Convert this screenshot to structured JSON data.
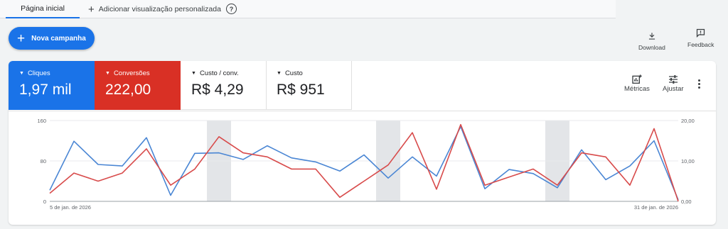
{
  "tabs": {
    "home": "Página inicial",
    "add_view": "Adicionar visualização personalizada"
  },
  "new_campaign": "Nova campanha",
  "tools": {
    "download": "Download",
    "feedback": "Feedback"
  },
  "metrics": [
    {
      "label": "Cliques",
      "value": "1,97 mil",
      "color": "#1a73e8"
    },
    {
      "label": "Conversões",
      "value": "222,00",
      "color": "#d93025"
    },
    {
      "label": "Custo / conv.",
      "value": "R$ 4,29"
    },
    {
      "label": "Custo",
      "value": "R$ 951"
    }
  ],
  "right_tools": {
    "metrics": "Métricas",
    "adjust": "Ajustar"
  },
  "chart_data": {
    "type": "line",
    "x_start_label": "5 de jan. de 2026",
    "x_end_label": "31 de jan. de 2026",
    "left_axis": {
      "ticks": [
        "0",
        "80",
        "160"
      ],
      "range": [
        0,
        160
      ]
    },
    "right_axis": {
      "ticks": [
        "0,00",
        "10,00",
        "20,00"
      ],
      "range": [
        0,
        20
      ]
    },
    "weekend_bands": [
      [
        6.5,
        7.5
      ],
      [
        13.5,
        14.5
      ],
      [
        20.5,
        21.5
      ]
    ],
    "series": [
      {
        "axis": "left",
        "color": "#4a86d4",
        "values": [
          22,
          119,
          73,
          70,
          126,
          12,
          95,
          96,
          83,
          110,
          86,
          78,
          60,
          92,
          46,
          88,
          50,
          148,
          25,
          63,
          55,
          27,
          102,
          43,
          70,
          120,
          3
        ]
      },
      {
        "axis": "right",
        "color": "#d84b4b",
        "values": [
          2,
          7,
          5,
          7,
          13,
          4,
          8,
          16,
          12,
          11,
          8,
          8,
          1,
          5,
          9,
          17,
          3,
          19,
          4,
          6,
          8,
          4,
          12,
          11,
          4,
          18,
          0
        ]
      }
    ]
  }
}
